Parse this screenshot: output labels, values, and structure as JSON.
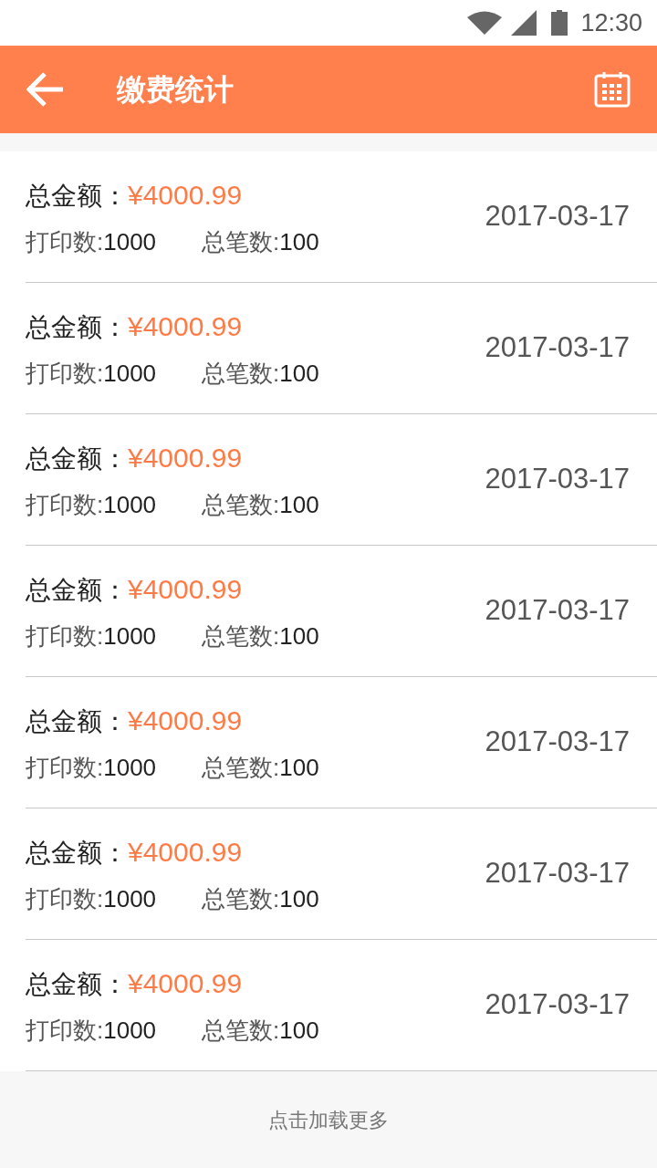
{
  "status_bar": {
    "time": "12:30"
  },
  "header": {
    "title": "缴费统计"
  },
  "records": [
    {
      "amount_label": "总金额：",
      "amount": "¥4000.99",
      "print_label": "打印数:",
      "print_count": "1000",
      "total_label": "总笔数:",
      "total_count": "100",
      "date": "2017-03-17"
    },
    {
      "amount_label": "总金额：",
      "amount": "¥4000.99",
      "print_label": "打印数:",
      "print_count": "1000",
      "total_label": "总笔数:",
      "total_count": "100",
      "date": "2017-03-17"
    },
    {
      "amount_label": "总金额：",
      "amount": "¥4000.99",
      "print_label": "打印数:",
      "print_count": "1000",
      "total_label": "总笔数:",
      "total_count": "100",
      "date": "2017-03-17"
    },
    {
      "amount_label": "总金额：",
      "amount": "¥4000.99",
      "print_label": "打印数:",
      "print_count": "1000",
      "total_label": "总笔数:",
      "total_count": "100",
      "date": "2017-03-17"
    },
    {
      "amount_label": "总金额：",
      "amount": "¥4000.99",
      "print_label": "打印数:",
      "print_count": "1000",
      "total_label": "总笔数:",
      "total_count": "100",
      "date": "2017-03-17"
    },
    {
      "amount_label": "总金额：",
      "amount": "¥4000.99",
      "print_label": "打印数:",
      "print_count": "1000",
      "total_label": "总笔数:",
      "total_count": "100",
      "date": "2017-03-17"
    },
    {
      "amount_label": "总金额：",
      "amount": "¥4000.99",
      "print_label": "打印数:",
      "print_count": "1000",
      "total_label": "总笔数:",
      "total_count": "100",
      "date": "2017-03-17"
    }
  ],
  "load_more": "点击加载更多"
}
